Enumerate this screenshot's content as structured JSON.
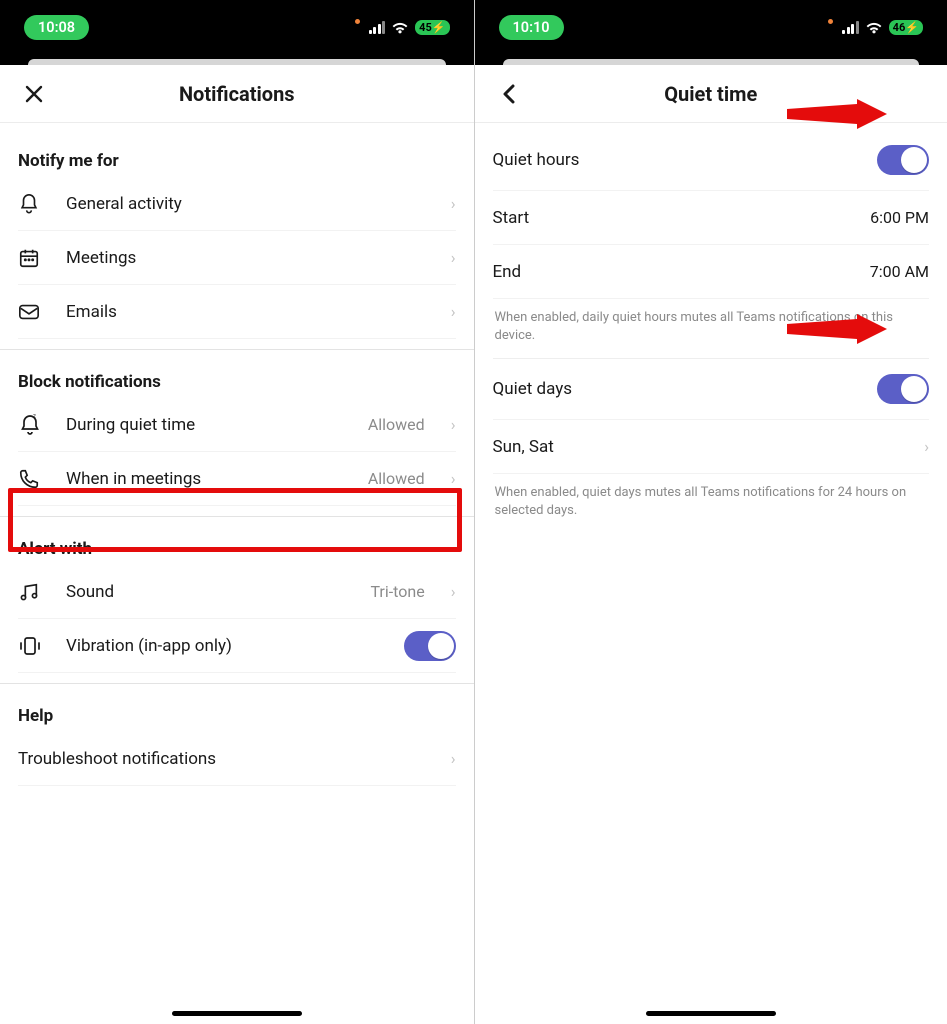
{
  "left": {
    "status": {
      "time": "10:08",
      "battery": "45"
    },
    "title": "Notifications",
    "s1": {
      "header": "Notify me for",
      "items": [
        {
          "label": "General activity",
          "icon": "bell-icon"
        },
        {
          "label": "Meetings",
          "icon": "calendar-icon"
        },
        {
          "label": "Emails",
          "icon": "mail-icon"
        }
      ]
    },
    "s2": {
      "header": "Block notifications",
      "items": [
        {
          "label": "During quiet time",
          "value": "Allowed",
          "icon": "quiet-bell-icon"
        },
        {
          "label": "When in meetings",
          "value": "Allowed",
          "icon": "phone-icon"
        }
      ]
    },
    "s3": {
      "header": "Alert with",
      "sound": {
        "label": "Sound",
        "value": "Tri-tone",
        "icon": "music-icon"
      },
      "vibration": {
        "label": "Vibration (in-app only)",
        "icon": "vibrate-icon"
      }
    },
    "s4": {
      "header": "Help",
      "item": {
        "label": "Troubleshoot notifications"
      }
    }
  },
  "right": {
    "status": {
      "time": "10:10",
      "battery": "46"
    },
    "title": "Quiet time",
    "quietHours": {
      "label": "Quiet hours",
      "startLabel": "Start",
      "startValue": "6:00 PM",
      "endLabel": "End",
      "endValue": "7:00 AM",
      "footer": "When enabled, daily quiet hours mutes all Teams notifications on this device."
    },
    "quietDays": {
      "label": "Quiet days",
      "daysValue": "Sun, Sat",
      "footer": "When enabled, quiet days mutes all Teams notifications for 24 hours on selected days."
    }
  }
}
